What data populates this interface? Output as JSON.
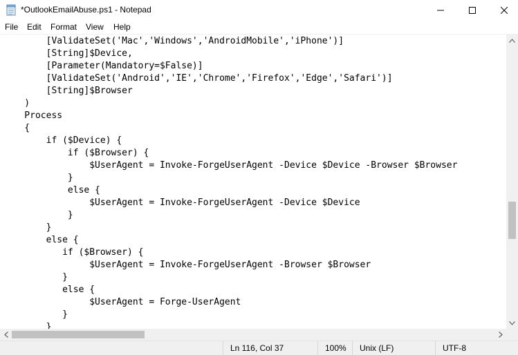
{
  "window": {
    "title": "*OutlookEmailAbuse.ps1 - Notepad"
  },
  "menu": {
    "items": [
      {
        "label": "File"
      },
      {
        "label": "Edit"
      },
      {
        "label": "Format"
      },
      {
        "label": "View"
      },
      {
        "label": "Help"
      }
    ]
  },
  "editor": {
    "lines": [
      "        [ValidateSet('Mac','Windows','AndroidMobile','iPhone')]",
      "        [String]$Device,",
      "        [Parameter(Mandatory=$False)]",
      "        [ValidateSet('Android','IE','Chrome','Firefox','Edge','Safari')]",
      "        [String]$Browser",
      "    )",
      "    Process",
      "    {",
      "        if ($Device) {",
      "            if ($Browser) {",
      "                $UserAgent = Invoke-ForgeUserAgent -Device $Device -Browser $Browser",
      "            }",
      "            else {",
      "                $UserAgent = Invoke-ForgeUserAgent -Device $Device",
      "            }",
      "        }",
      "        else {",
      "           if ($Browser) {",
      "                $UserAgent = Invoke-ForgeUserAgent -Browser $Browser",
      "           }",
      "           else {",
      "                $UserAgent = Forge-UserAgent",
      "           }",
      "        }"
    ]
  },
  "status": {
    "position": "Ln 116, Col 37",
    "zoom": "100%",
    "line_ending": "Unix (LF)",
    "encoding": "UTF-8"
  },
  "colors": {
    "scroll_track": "#f0f0f0",
    "scroll_thumb": "#c1c1c1",
    "status_bg": "#f0f0f0"
  },
  "icons": {
    "app": "notepad-icon",
    "minimize": "minimize-icon",
    "maximize": "maximize-icon",
    "close": "close-icon"
  }
}
